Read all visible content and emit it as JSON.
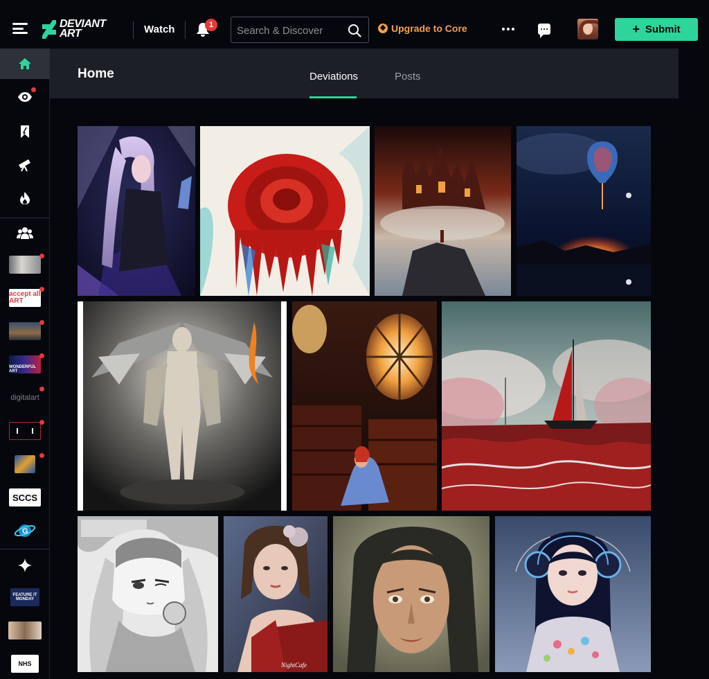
{
  "app": {
    "logo_text_line1": "DEVIANT",
    "logo_text_line2": "ART",
    "watch_label": "Watch",
    "notification_count": "1",
    "search_placeholder": "Search & Discover",
    "upgrade_label": "Upgrade to Core",
    "submit_label": "Submit"
  },
  "colors": {
    "accent": "#2dd59a",
    "upgrade": "#f4a04f",
    "badge": "#e23b3b",
    "background": "#06070d",
    "panel": "#1c1f26"
  },
  "sidebar": {
    "nav_items": [
      {
        "icon": "home-icon",
        "active": true
      },
      {
        "icon": "eye-icon",
        "has_dot": true
      },
      {
        "icon": "bookmark-icon"
      },
      {
        "icon": "telescope-icon"
      },
      {
        "icon": "flame-icon"
      },
      {
        "icon": "groups-icon"
      }
    ],
    "groups": [
      {
        "name": "group-1",
        "text": "",
        "has_dot": true
      },
      {
        "name": "group-accept-all-art",
        "text": "accept all ART",
        "has_dot": true
      },
      {
        "name": "group-3",
        "text": "",
        "has_dot": true
      },
      {
        "name": "group-wonderful-art",
        "text": "WONDERFUL ART",
        "has_dot": true
      },
      {
        "name": "group-digitalart",
        "text": "digitalart",
        "has_dot": true
      },
      {
        "name": "group-6",
        "text": "",
        "has_dot": true
      },
      {
        "name": "group-7",
        "text": "",
        "has_dot": true
      },
      {
        "name": "group-sccs",
        "text": "SCCS"
      },
      {
        "name": "group-9",
        "text": ""
      }
    ],
    "bottom": [
      {
        "icon": "sparkle-icon"
      },
      {
        "name": "group-feature-it-monday",
        "text": "FEATURE IT MONDAY"
      },
      {
        "name": "group-12",
        "text": ""
      },
      {
        "name": "group-13",
        "text": "NHS"
      }
    ]
  },
  "main": {
    "title": "Home",
    "tabs": [
      "Deviations",
      "Posts"
    ],
    "active_tab": "Deviations"
  },
  "gallery": {
    "watermarks": [
      "NightCafe"
    ]
  }
}
